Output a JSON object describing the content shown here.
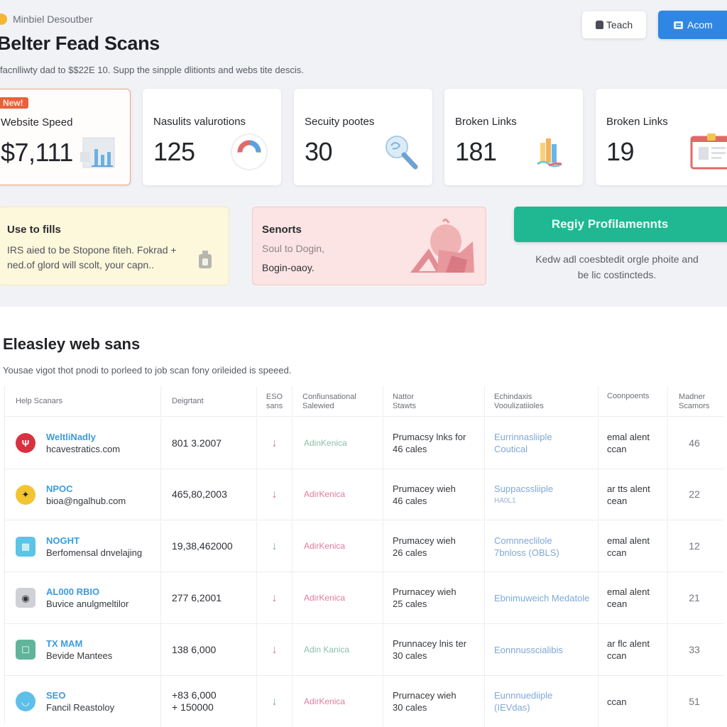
{
  "header": {
    "brand": "Minbiel Desoutber",
    "title": "Belter Fead Scans",
    "subtitle": "facnlliwty dad to $$22E 10. Supp the sinpple dlitionts and webs tite descis.",
    "buttons": {
      "teach": "Teach",
      "acom": "Acom"
    }
  },
  "stats": [
    {
      "badge": "New!",
      "label": "Website Speed",
      "value": "$7,111",
      "icon": "bar-chart-icon"
    },
    {
      "label": "Nasulits valurotions",
      "value": "125",
      "icon": "donut-chart-icon"
    },
    {
      "label": "Secuity pootes",
      "value": "30",
      "icon": "magnifier-icon"
    },
    {
      "label": "Broken Links",
      "value": "181",
      "icon": "bar-stack-icon"
    },
    {
      "label": "Broken Links",
      "value": "19",
      "icon": "clipboard-icon"
    }
  ],
  "promos": {
    "yellow": {
      "title": "Use to fills",
      "line1": "IRS aied to be Stopone fiteh. Fokrad +",
      "line2": "ned.of glord will scolt, your capn.."
    },
    "pink": {
      "title": "Senorts",
      "line1": "Soul to Dogin,",
      "line2": "Bogin-oaoy."
    }
  },
  "cta": {
    "label": "Regiy Profilamennts",
    "note_line1": "Kedw adl coesbtedit orgle phoite and",
    "note_line2": "be lic costincteds."
  },
  "section": {
    "title": "Eleasley web sans",
    "subtitle": "Yousae vigot thot pnodi to porleed to job scan fony orileided is speeed."
  },
  "table": {
    "headers": {
      "name": "Help Scanars",
      "desig": "Deigrtant",
      "eso1": "ESO",
      "eso2": "sans",
      "conf1": "Confiunsational",
      "conf2": "Salewied",
      "notr1": "Nattor",
      "notr2": "Stawts",
      "echi1": "Echindaxis",
      "echi2": "Vooulizatiioles",
      "comp": "Coonpoents",
      "mad1": "Madner",
      "mad2": "Scamors"
    },
    "rows": [
      {
        "title": "WeltliNadly",
        "sub": "hcavestratics.com",
        "icon_color": "#d8313f",
        "icon_glyph": "Ψ",
        "desig1": "801 3.2007",
        "desig2": "",
        "eso": "↓",
        "eso_tone": "red",
        "conf": "AdinKenica",
        "conf_tone": "green",
        "notr1": "Prumacsy lnks for",
        "notr2": "46 cales",
        "echi1": "Eurrinnasliiple",
        "echi2": "Coutical",
        "comp1": "emal alent",
        "comp2": "ccan",
        "mad": "46"
      },
      {
        "title": "NPOC",
        "sub": "bioa@ngalhub.com",
        "icon_color": "#f2c531",
        "icon_glyph": "✦",
        "desig1": "465,80,2003",
        "desig2": "",
        "eso": "↓",
        "eso_tone": "red",
        "conf": "AdirKenica",
        "conf_tone": "pink",
        "notr1": "Prumacey wieh",
        "notr2": "46 cales",
        "echi1": "Suppacssliiple",
        "echi2": "HA0L1",
        "comp1": "ar tts alent",
        "comp2": "cean",
        "mad": "22"
      },
      {
        "title": "NOGHT",
        "sub": "Berfomensal dnvelajing",
        "icon_color": "#5cc4e6",
        "icon_glyph": "▦",
        "desig1": "19,38,462000",
        "desig2": "",
        "eso": "↓",
        "eso_tone": "green",
        "conf": "AdirKenica",
        "conf_tone": "pink",
        "notr1": "Prumacey wieh",
        "notr2": "26 cales",
        "echi1": "Comnneclilole",
        "echi2": "7bnloss (OBLS)",
        "comp1": "emal alent",
        "comp2": "ccan",
        "mad": "12"
      },
      {
        "title": "AL000 RBIO",
        "sub": "Buvice anulgmeltilor",
        "icon_color": "#cfd1d6",
        "icon_glyph": "◉",
        "desig1": "277 6,2001",
        "desig2": "",
        "eso": "↓",
        "eso_tone": "red",
        "conf": "AdirKenica",
        "conf_tone": "pink",
        "notr1": "Prurnacey wieh",
        "notr2": "25 cales",
        "echi1": "Ebnimuweich Medatole",
        "echi2": "",
        "comp1": "emal alent",
        "comp2": "cean",
        "mad": "21"
      },
      {
        "title": "TX MAM",
        "sub": "Bevide Mantees",
        "icon_color": "#5fb49a",
        "icon_glyph": "☐",
        "desig1": "138 6,000",
        "desig2": "",
        "eso": "↓",
        "eso_tone": "red",
        "conf": "Adin Kanica",
        "conf_tone": "green",
        "notr1": "Prunnacey lnis ter",
        "notr2": "30 cales",
        "echi1": "Eonnnusscialibis",
        "echi2": "",
        "comp1": "ar flc alent",
        "comp2": "ccan",
        "mad": "33"
      },
      {
        "title": "SEO",
        "sub": "Fancil Reastoloy",
        "icon_color": "#5ec0e8",
        "icon_glyph": "◡",
        "desig1": "+83 6,000",
        "desig2": "+ 150000",
        "eso": "↓",
        "eso_tone": "green",
        "conf": "AdirKenica",
        "conf_tone": "pink",
        "notr1": "Prurnacey wieh",
        "notr2": "30 cales",
        "echi1": "Eunnnuediiple",
        "echi2": "(IEVdas)",
        "comp1": "ccan",
        "comp2": "",
        "mad": "51"
      }
    ]
  }
}
